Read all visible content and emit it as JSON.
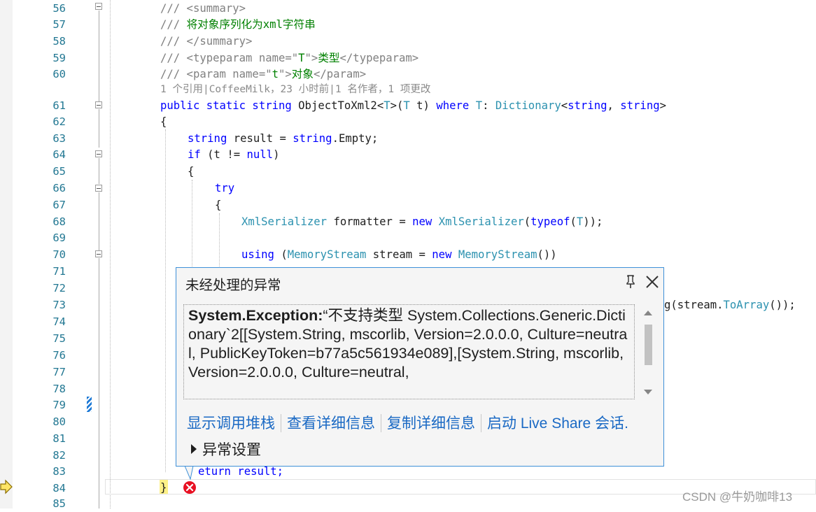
{
  "editor": {
    "line_numbers": [
      "56",
      "57",
      "58",
      "59",
      "60",
      "61",
      "62",
      "63",
      "64",
      "65",
      "66",
      "67",
      "68",
      "69",
      "70",
      "71",
      "72",
      "73",
      "74",
      "75",
      "76",
      "77",
      "78",
      "79",
      "80",
      "81",
      "82",
      "83",
      "84",
      "85"
    ],
    "codelens": "1 个引用|CoffeeMilk，23 小时前|1 名作者，1 项更改",
    "code": {
      "l56": {
        "cmt": "/// <summary>"
      },
      "l57": {
        "cmt_prefix": "/// ",
        "cmt_text": "将对象序列化为xml字符串"
      },
      "l58": {
        "cmt": "/// </summary>"
      },
      "l59": {
        "p1": "/// <typeparam name=\"",
        "p2": "T",
        "p3": "\">",
        "p4": "类型",
        "p5": "</typeparam>"
      },
      "l60": {
        "p1": "/// <param name=\"",
        "p2": "t",
        "p3": "\">",
        "p4": "对象",
        "p5": "</param>"
      },
      "l61": {
        "kw1": "public static string ",
        "name": "ObjectToXml2<",
        "tp1": "T",
        "mid": ">(",
        "tp2": "T",
        "arg": " t) ",
        "kw2": "where ",
        "tp3": "T",
        "colon": ": ",
        "dict": "Dictionary",
        "lt": "<",
        "kw3": "string",
        "comma": ", ",
        "kw4": "string",
        "gt": ">"
      },
      "l62": {
        "text": "{"
      },
      "l63": {
        "kw1": "string",
        "a": " result = ",
        "kw2": "string",
        "b": ".Empty;"
      },
      "l64": {
        "kw1": "if",
        "a": " (t != ",
        "kw2": "null",
        "b": ")"
      },
      "l65": {
        "text": "{"
      },
      "l66": {
        "kw": "try"
      },
      "l67": {
        "text": "{"
      },
      "l68": {
        "t1": "XmlSerializer",
        "a": " formatter = ",
        "kw1": "new",
        "sp": " ",
        "t2": "XmlSerializer",
        "b": "(",
        "kw2": "typeof",
        "c": "(",
        "t3": "T",
        "d": "));"
      },
      "l70": {
        "kw1": "using",
        "a": " (",
        "t1": "MemoryStream",
        "b": " stream = ",
        "kw2": "new",
        "sp": " ",
        "t2": "MemoryStream",
        "c": "())"
      },
      "l73": {
        "a": "g(stream.",
        "m": "ToArray",
        "b": "());"
      },
      "l83": {
        "a": "eturn result;"
      },
      "l84": {
        "text": "}"
      }
    }
  },
  "popup": {
    "title": "未经处理的异常",
    "exception_type": "System.Exception:",
    "message": "“不支持类型 System.Collections.Generic.Dictionary`2[[System.String, mscorlib, Version=2.0.0.0, Culture=neutral, PublicKeyToken=b77a5c561934e089],[System.String, mscorlib, Version=2.0.0.0, Culture=neutral,",
    "links": [
      "显示调用堆栈",
      "查看详细信息",
      "复制详细信息",
      "启动 Live Share 会话."
    ],
    "settings_label": "异常设置"
  },
  "watermark": "CSDN @牛奶咖啡13",
  "colors": {
    "keyword": "#0000ff",
    "type": "#2b91af",
    "comment": "#008000",
    "link": "#1a69c4",
    "popup_border": "#3e90d8",
    "error": "#e81123"
  },
  "icons": [
    "execution-arrow-icon",
    "error-icon",
    "pin-icon",
    "close-icon",
    "expand-triangle-icon",
    "scroll-up-icon",
    "scroll-down-icon"
  ]
}
